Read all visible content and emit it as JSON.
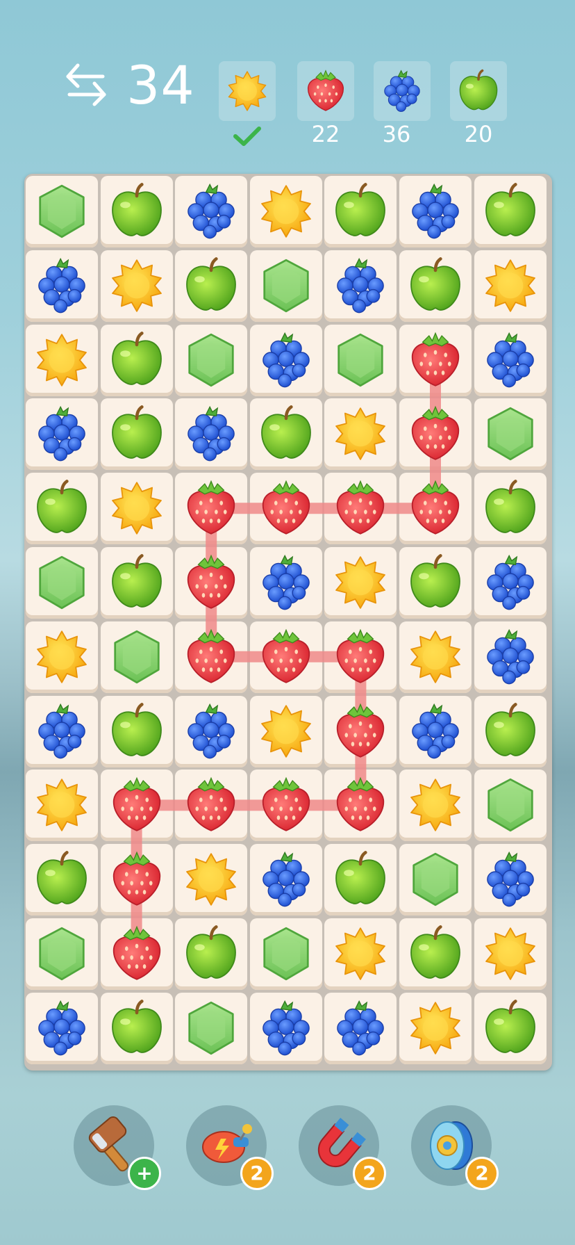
{
  "hud": {
    "moves_icon": "swap-arrows-icon",
    "moves_left": "34",
    "goals": [
      {
        "fruit": "sun",
        "count": "",
        "completed": true
      },
      {
        "fruit": "strawberry",
        "count": "22",
        "completed": false
      },
      {
        "fruit": "blueberry",
        "count": "36",
        "completed": false
      },
      {
        "fruit": "apple",
        "count": "20",
        "completed": false
      }
    ]
  },
  "board": {
    "rows": 12,
    "cols": 7,
    "grid": [
      [
        "hex",
        "apple",
        "blueberry",
        "sun",
        "apple",
        "blueberry",
        "apple"
      ],
      [
        "blueberry",
        "sun",
        "apple",
        "hex",
        "blueberry",
        "apple",
        "sun"
      ],
      [
        "sun",
        "apple",
        "hex",
        "blueberry",
        "hex",
        "strawberry",
        "blueberry"
      ],
      [
        "blueberry",
        "apple",
        "blueberry",
        "apple",
        "sun",
        "strawberry",
        "hex"
      ],
      [
        "apple",
        "sun",
        "strawberry",
        "strawberry",
        "strawberry",
        "strawberry",
        "apple"
      ],
      [
        "hex",
        "apple",
        "strawberry",
        "blueberry",
        "sun",
        "apple",
        "blueberry"
      ],
      [
        "sun",
        "hex",
        "strawberry",
        "strawberry",
        "strawberry",
        "sun",
        "blueberry"
      ],
      [
        "blueberry",
        "apple",
        "blueberry",
        "sun",
        "strawberry",
        "blueberry",
        "apple"
      ],
      [
        "sun",
        "strawberry",
        "strawberry",
        "strawberry",
        "strawberry",
        "sun",
        "hex"
      ],
      [
        "apple",
        "strawberry",
        "sun",
        "blueberry",
        "apple",
        "hex",
        "blueberry"
      ],
      [
        "hex",
        "strawberry",
        "apple",
        "hex",
        "sun",
        "apple",
        "sun"
      ],
      [
        "blueberry",
        "apple",
        "hex",
        "blueberry",
        "blueberry",
        "sun",
        "apple"
      ]
    ],
    "selected_path": [
      [
        2,
        5
      ],
      [
        3,
        5
      ],
      [
        4,
        5
      ],
      [
        4,
        4
      ],
      [
        4,
        3
      ],
      [
        4,
        2
      ],
      [
        5,
        2
      ],
      [
        6,
        2
      ],
      [
        6,
        3
      ],
      [
        6,
        4
      ],
      [
        7,
        4
      ],
      [
        8,
        4
      ],
      [
        8,
        3
      ],
      [
        8,
        2
      ],
      [
        8,
        1
      ],
      [
        9,
        1
      ],
      [
        10,
        1
      ]
    ]
  },
  "boosters": [
    {
      "icon": "hammer-icon",
      "badge": "+",
      "badge_type": "add"
    },
    {
      "icon": "blaster-icon",
      "badge": "2",
      "badge_type": "count"
    },
    {
      "icon": "magnet-icon",
      "badge": "2",
      "badge_type": "count"
    },
    {
      "icon": "yoyo-icon",
      "badge": "2",
      "badge_type": "count"
    }
  ],
  "colors": {
    "tile": "#fbf1e6",
    "board": "#c7bfb6",
    "link": "#f08a8a",
    "badge_count": "#f3a51c",
    "badge_add": "#3cb44a",
    "check": "#3cb44a"
  }
}
